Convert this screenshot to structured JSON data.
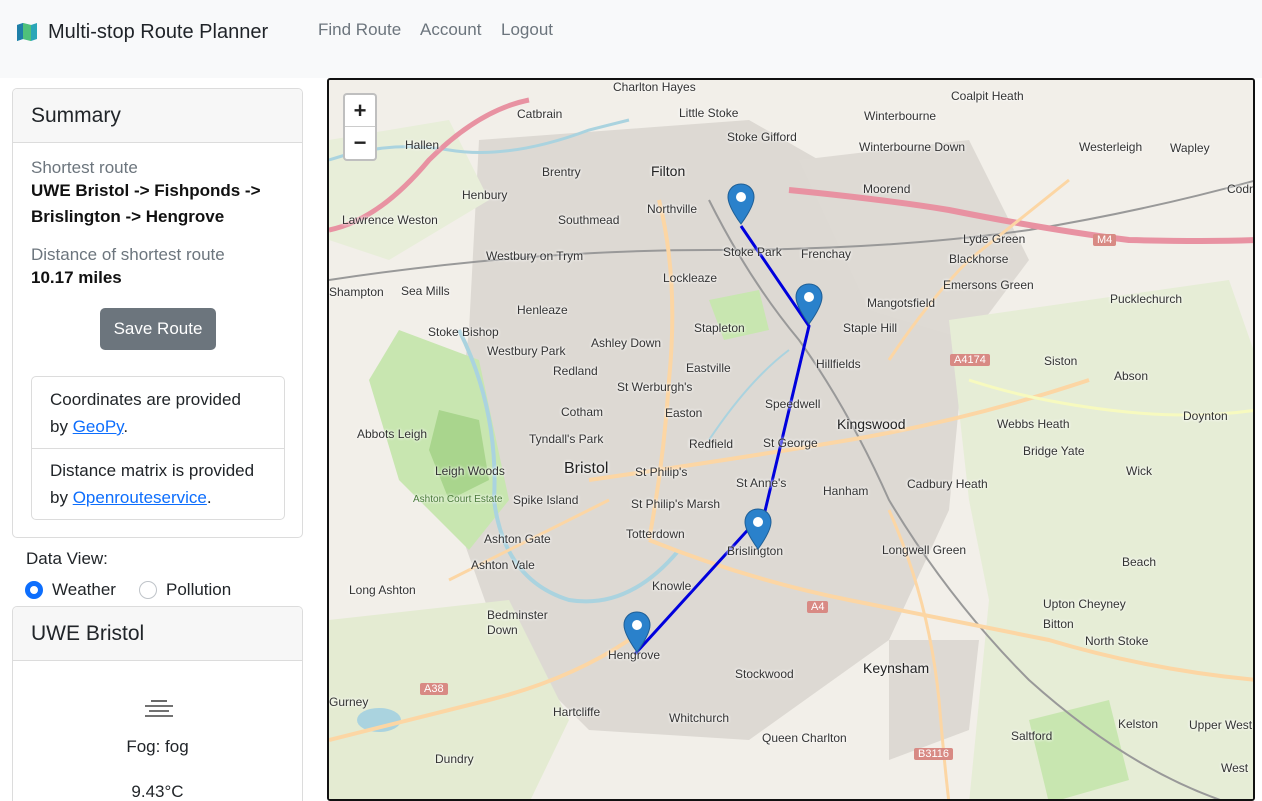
{
  "navbar": {
    "brand": "Multi-stop Route Planner",
    "links": [
      "Find Route",
      "Account",
      "Logout"
    ]
  },
  "summary": {
    "title": "Summary",
    "shortest_route_label": "Shortest route",
    "shortest_route_line1": "UWE Bristol -> Fishponds ->",
    "shortest_route_line2": "Brislington -> Hengrove",
    "distance_label": "Distance of shortest route",
    "distance_value": "10.17 miles",
    "save_button": "Save Route",
    "credits": {
      "coords_line1": "Coordinates are provided",
      "coords_by": "by ",
      "coords_link": "GeoPy",
      "coords_end": ".",
      "matrix_line1": "Distance matrix is provided",
      "matrix_by": "by ",
      "matrix_link": "Openrouteservice",
      "matrix_end": "."
    }
  },
  "data_view": {
    "label": "Data View:",
    "options": [
      "Weather",
      "Pollution"
    ],
    "selected": "Weather"
  },
  "weather": {
    "location": "UWE Bristol",
    "icon": "fog-icon",
    "condition": "Fog: fog",
    "temperature": "9.43°C"
  },
  "map": {
    "zoom_in": "+",
    "zoom_out": "−",
    "route_color": "#0000dd",
    "labels": [
      {
        "text": "Charlton Hayes"
      },
      {
        "text": "Little Stoke"
      },
      {
        "text": "Catbrain"
      },
      {
        "text": "Stoke Gifford"
      },
      {
        "text": "Winterbourne"
      },
      {
        "text": "Coalpit Heath"
      },
      {
        "text": "Hallen"
      },
      {
        "text": "Winterbourne Down"
      },
      {
        "text": "Westerleigh"
      },
      {
        "text": "Wapley"
      },
      {
        "text": "Brentry"
      },
      {
        "text": "Filton"
      },
      {
        "text": "Henbury"
      },
      {
        "text": "Northville"
      },
      {
        "text": "Moorend"
      },
      {
        "text": "Codring"
      },
      {
        "text": "Lawrence Weston"
      },
      {
        "text": "Southmead"
      },
      {
        "text": "Lyde Green"
      },
      {
        "text": "Stoke Park"
      },
      {
        "text": "Frenchay"
      },
      {
        "text": "Blackhorse"
      },
      {
        "text": "Westbury on Trym"
      },
      {
        "text": "Lockleaze"
      },
      {
        "text": "Emersons Green"
      },
      {
        "text": "Pucklechurch"
      },
      {
        "text": "Shampton"
      },
      {
        "text": "Sea Mills"
      },
      {
        "text": "Henleaze"
      },
      {
        "text": "Mangotsfield"
      },
      {
        "text": "Stoke Bishop"
      },
      {
        "text": "Stapleton"
      },
      {
        "text": "Staple Hill"
      },
      {
        "text": "Westbury Park"
      },
      {
        "text": "Ashley Down"
      },
      {
        "text": "Siston"
      },
      {
        "text": "Redland"
      },
      {
        "text": "Hillfields"
      },
      {
        "text": "Abson"
      },
      {
        "text": "Eastville"
      },
      {
        "text": "St Werburgh's"
      },
      {
        "text": "Cotham"
      },
      {
        "text": "Easton"
      },
      {
        "text": "Speedwell"
      },
      {
        "text": "Kingswood"
      },
      {
        "text": "Webbs Heath"
      },
      {
        "text": "Doynton"
      },
      {
        "text": "Abbots Leigh"
      },
      {
        "text": "Tyndall's Park"
      },
      {
        "text": "Redfield"
      },
      {
        "text": "St George"
      },
      {
        "text": "Bridge Yate"
      },
      {
        "text": "Bristol"
      },
      {
        "text": "St Philip's"
      },
      {
        "text": "Leigh Woods"
      },
      {
        "text": "Wick"
      },
      {
        "text": "St Anne's"
      },
      {
        "text": "Cadbury Heath"
      },
      {
        "text": "Spike Island"
      },
      {
        "text": "St Philip's Marsh"
      },
      {
        "text": "Hanham"
      },
      {
        "text": "Ashton Court Estate"
      },
      {
        "text": "Totterdown"
      },
      {
        "text": "Brislington"
      },
      {
        "text": "Ashton Gate"
      },
      {
        "text": "Longwell Green"
      },
      {
        "text": "Ashton Vale"
      },
      {
        "text": "Beach"
      },
      {
        "text": "Knowle"
      },
      {
        "text": "Long Ashton"
      },
      {
        "text": "Upton Cheyney"
      },
      {
        "text": "Bedminster Down"
      },
      {
        "text": "Bitton"
      },
      {
        "text": "North Stoke"
      },
      {
        "text": "Hengrove"
      },
      {
        "text": "Keynsham"
      },
      {
        "text": "Stockwood"
      },
      {
        "text": "Gurney"
      },
      {
        "text": "Hartcliffe"
      },
      {
        "text": "Whitchurch"
      },
      {
        "text": "Kelston"
      },
      {
        "text": "Upper West"
      },
      {
        "text": "Queen Charlton"
      },
      {
        "text": "Saltford"
      },
      {
        "text": "Dundry"
      },
      {
        "text": "West"
      }
    ],
    "road_tags": [
      "M4",
      "A4174",
      "A4",
      "A38",
      "B3116"
    ]
  }
}
